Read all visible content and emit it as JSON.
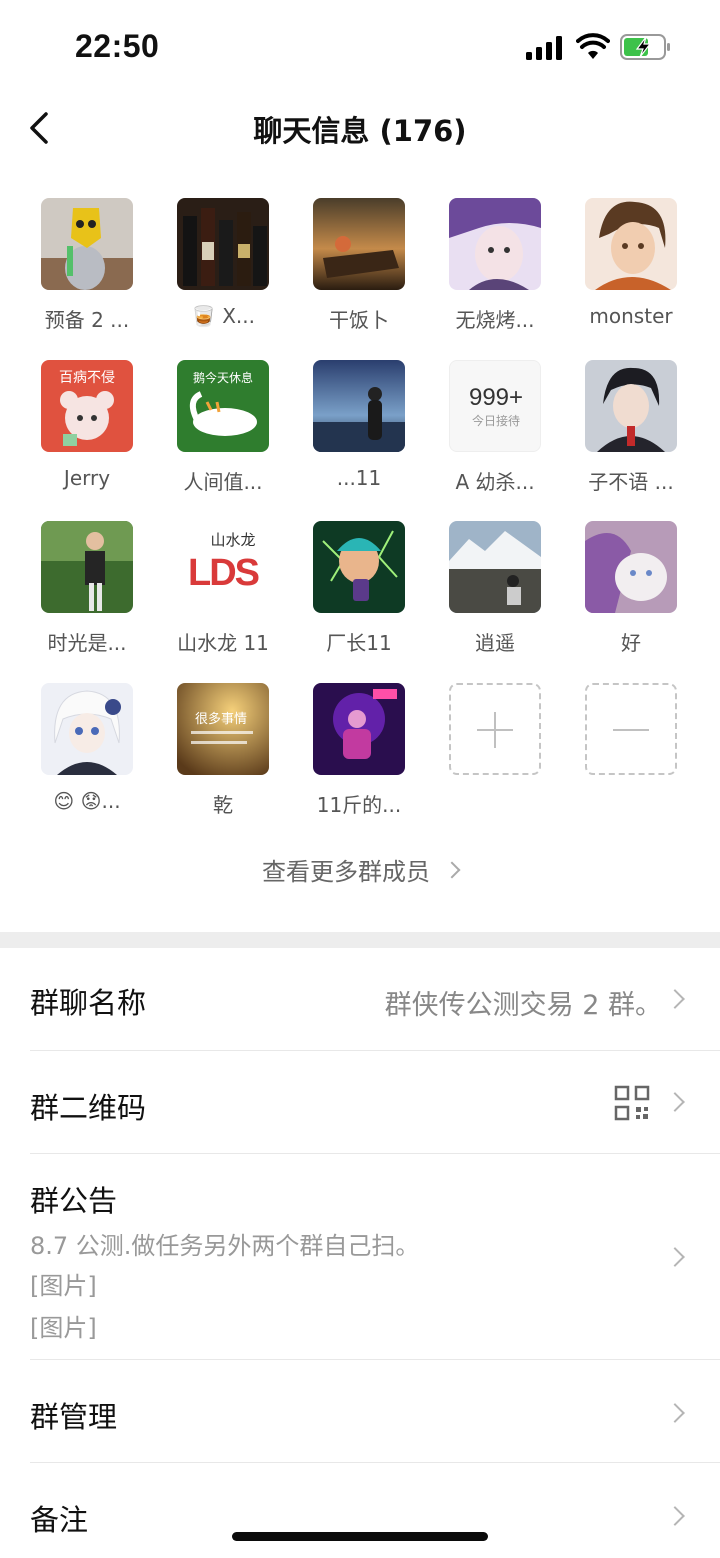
{
  "status_bar": {
    "time": "22:50"
  },
  "nav": {
    "title": "聊天信息 (176)"
  },
  "members": [
    {
      "name": "预备 2 ...",
      "avatar": "masked-person-photo"
    },
    {
      "name": "🥃 X...",
      "avatar": "wine-bottles-photo"
    },
    {
      "name": "干饭卜",
      "avatar": "sunset-boat-photo"
    },
    {
      "name": "无烧烤...",
      "avatar": "anime-boy-illustration"
    },
    {
      "name": "monster",
      "avatar": "anime-girl-illustration"
    },
    {
      "name": "Jerry",
      "avatar": "baby-mouse-illustration",
      "text": "百病不侵"
    },
    {
      "name": "人间值...",
      "avatar": "white-goose-illustration",
      "text": "鹅今天休息"
    },
    {
      "name": "...11",
      "avatar": "man-at-sea-illustration"
    },
    {
      "name": "A 幼杀...",
      "avatar": "badge-999",
      "text": "999+",
      "subtext": "今日接待"
    },
    {
      "name": "子不语 ...",
      "avatar": "anime-swordsman-illustration"
    },
    {
      "name": "时光是...",
      "avatar": "man-outdoor-photo"
    },
    {
      "name": "山水龙 11",
      "avatar": "lds-logo",
      "text": "山水龙",
      "logo": "LDS"
    },
    {
      "name": "厂长11",
      "avatar": "cartoon-boy-drink-illustration"
    },
    {
      "name": "逍遥",
      "avatar": "mountain-landscape-photo"
    },
    {
      "name": "好",
      "avatar": "white-cat-photo"
    },
    {
      "name": "😊 😟...",
      "avatar": "white-hair-anime-illustration"
    },
    {
      "name": "乾",
      "avatar": "golden-text-photo",
      "text": "很多事情"
    },
    {
      "name": "11斤的...",
      "avatar": "neon-purple-photo"
    }
  ],
  "actions": {
    "add_icon": "plus-icon",
    "remove_icon": "minus-icon"
  },
  "more_members": {
    "label": "查看更多群成员"
  },
  "settings": {
    "group_name": {
      "label": "群聊名称",
      "value": "群侠传公测交易 2 群。"
    },
    "qr_code": {
      "label": "群二维码",
      "icon": "qr-code-icon"
    },
    "notice": {
      "label": "群公告",
      "lines": [
        "8.7 公测.做任务另外两个群自己扫。",
        "[图片]",
        "[图片]"
      ]
    },
    "manage": {
      "label": "群管理"
    },
    "remark": {
      "label": "备注"
    }
  },
  "colors": {
    "background": "#ffffff",
    "section_gap": "#ededed",
    "secondary_text": "#888888",
    "dashed_border": "#c5c5c5"
  }
}
